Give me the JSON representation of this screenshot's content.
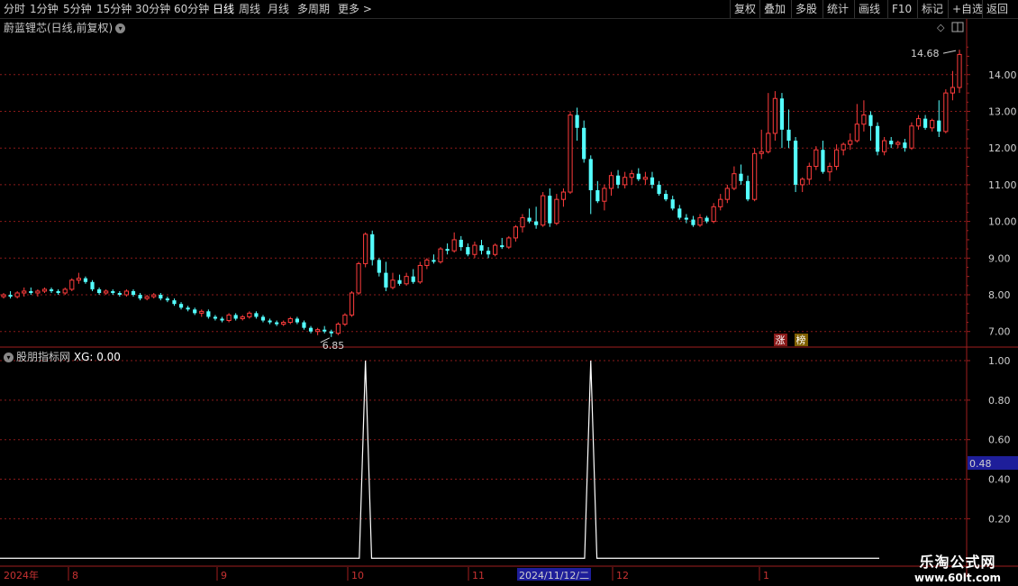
{
  "toolbar": {
    "periods": [
      "分时",
      "1分钟",
      "5分钟",
      "15分钟",
      "30分钟",
      "60分钟",
      "日线",
      "周线",
      "月线",
      "多周期",
      "更多 >"
    ],
    "active_period": "日线",
    "right_buttons": [
      "复权",
      "叠加",
      "多股",
      "统计",
      "画线",
      "F10",
      "标记",
      "+自选",
      "返回"
    ]
  },
  "main_panel": {
    "title": "蔚蓝锂芯(日线,前复权)",
    "high_label": "14.68",
    "low_label": "6.85",
    "badges": [
      "涨",
      "榜"
    ]
  },
  "sub_panel": {
    "title": "股朋指标网",
    "value_label": "XG: 0.00",
    "current_value": "0.48"
  },
  "timeline": {
    "labels": [
      "2024年",
      "8",
      "9",
      "10",
      "11",
      "12",
      "1"
    ],
    "highlighted_date": "2024/11/12/二"
  },
  "watermark": {
    "line1": "乐淘公式网",
    "line2": "www.60lt.com"
  },
  "colors": {
    "up": "#ff3c3c",
    "down": "#54ffff",
    "grid": "#8b1a1a",
    "axis": "#a01e1e",
    "signal": "#ffffff"
  },
  "chart_data": {
    "type": "candlestick",
    "main_yaxis": {
      "ticks": [
        7.0,
        8.0,
        9.0,
        10.0,
        11.0,
        12.0,
        13.0,
        14.0
      ],
      "ylim": [
        6.6,
        15.1
      ]
    },
    "sub_yaxis": {
      "ticks": [
        0.2,
        0.4,
        0.6,
        0.8,
        1.0
      ],
      "ylim": [
        -0.04,
        1.0
      ]
    },
    "candles_ohlc": [
      [
        7.95,
        8.05,
        7.9,
        8.0
      ],
      [
        8.0,
        8.1,
        7.9,
        7.95
      ],
      [
        7.95,
        8.1,
        7.9,
        8.05
      ],
      [
        8.05,
        8.2,
        7.95,
        8.1
      ],
      [
        8.1,
        8.2,
        8.0,
        8.05
      ],
      [
        8.05,
        8.15,
        7.95,
        8.1
      ],
      [
        8.1,
        8.2,
        8.05,
        8.15
      ],
      [
        8.15,
        8.2,
        8.05,
        8.1
      ],
      [
        8.1,
        8.15,
        8.0,
        8.05
      ],
      [
        8.05,
        8.2,
        8.0,
        8.15
      ],
      [
        8.15,
        8.45,
        8.1,
        8.4
      ],
      [
        8.4,
        8.6,
        8.3,
        8.45
      ],
      [
        8.45,
        8.5,
        8.3,
        8.35
      ],
      [
        8.35,
        8.4,
        8.1,
        8.15
      ],
      [
        8.15,
        8.2,
        8.0,
        8.05
      ],
      [
        8.05,
        8.15,
        8.0,
        8.1
      ],
      [
        8.1,
        8.15,
        8.0,
        8.05
      ],
      [
        8.05,
        8.1,
        7.95,
        8.0
      ],
      [
        8.0,
        8.15,
        7.95,
        8.1
      ],
      [
        8.1,
        8.15,
        7.95,
        8.0
      ],
      [
        8.0,
        8.05,
        7.85,
        7.9
      ],
      [
        7.9,
        8.0,
        7.85,
        7.95
      ],
      [
        7.95,
        8.05,
        7.9,
        8.0
      ],
      [
        8.0,
        8.05,
        7.85,
        7.9
      ],
      [
        7.9,
        7.95,
        7.8,
        7.85
      ],
      [
        7.85,
        7.9,
        7.7,
        7.75
      ],
      [
        7.75,
        7.8,
        7.6,
        7.65
      ],
      [
        7.65,
        7.7,
        7.55,
        7.6
      ],
      [
        7.6,
        7.65,
        7.45,
        7.5
      ],
      [
        7.5,
        7.6,
        7.4,
        7.55
      ],
      [
        7.55,
        7.6,
        7.35,
        7.4
      ],
      [
        7.4,
        7.45,
        7.3,
        7.35
      ],
      [
        7.35,
        7.4,
        7.25,
        7.3
      ],
      [
        7.3,
        7.5,
        7.25,
        7.45
      ],
      [
        7.45,
        7.5,
        7.3,
        7.35
      ],
      [
        7.35,
        7.45,
        7.3,
        7.4
      ],
      [
        7.4,
        7.55,
        7.35,
        7.5
      ],
      [
        7.5,
        7.55,
        7.35,
        7.4
      ],
      [
        7.4,
        7.45,
        7.25,
        7.3
      ],
      [
        7.3,
        7.35,
        7.2,
        7.25
      ],
      [
        7.25,
        7.3,
        7.15,
        7.2
      ],
      [
        7.2,
        7.3,
        7.15,
        7.25
      ],
      [
        7.25,
        7.4,
        7.2,
        7.35
      ],
      [
        7.35,
        7.4,
        7.2,
        7.25
      ],
      [
        7.25,
        7.3,
        7.05,
        7.1
      ],
      [
        7.1,
        7.15,
        6.95,
        7.0
      ],
      [
        7.0,
        7.1,
        6.9,
        7.05
      ],
      [
        7.05,
        7.15,
        6.95,
        7.0
      ],
      [
        7.0,
        7.05,
        6.85,
        6.95
      ],
      [
        6.95,
        7.25,
        6.9,
        7.2
      ],
      [
        7.2,
        7.5,
        7.15,
        7.45
      ],
      [
        7.45,
        8.1,
        7.4,
        8.05
      ],
      [
        8.05,
        8.9,
        8.0,
        8.85
      ],
      [
        8.85,
        9.7,
        8.75,
        9.65
      ],
      [
        9.65,
        9.75,
        8.8,
        8.95
      ],
      [
        8.95,
        9.0,
        8.5,
        8.6
      ],
      [
        8.6,
        8.9,
        8.1,
        8.2
      ],
      [
        8.2,
        8.6,
        8.15,
        8.4
      ],
      [
        8.4,
        8.55,
        8.25,
        8.3
      ],
      [
        8.3,
        8.6,
        8.25,
        8.5
      ],
      [
        8.5,
        8.7,
        8.3,
        8.35
      ],
      [
        8.35,
        8.9,
        8.3,
        8.8
      ],
      [
        8.8,
        9.0,
        8.7,
        8.95
      ],
      [
        8.95,
        9.1,
        8.85,
        8.9
      ],
      [
        8.9,
        9.3,
        8.85,
        9.25
      ],
      [
        9.25,
        9.4,
        9.1,
        9.2
      ],
      [
        9.2,
        9.7,
        9.15,
        9.5
      ],
      [
        9.5,
        9.6,
        9.2,
        9.3
      ],
      [
        9.3,
        9.4,
        9.05,
        9.1
      ],
      [
        9.1,
        9.45,
        9.0,
        9.35
      ],
      [
        9.35,
        9.5,
        9.1,
        9.2
      ],
      [
        9.2,
        9.3,
        9.0,
        9.1
      ],
      [
        9.1,
        9.4,
        9.05,
        9.35
      ],
      [
        9.35,
        9.55,
        9.25,
        9.3
      ],
      [
        9.3,
        9.6,
        9.25,
        9.55
      ],
      [
        9.55,
        9.9,
        9.45,
        9.85
      ],
      [
        9.85,
        10.2,
        9.7,
        10.1
      ],
      [
        10.1,
        10.35,
        9.95,
        10.0
      ],
      [
        10.0,
        10.4,
        9.8,
        9.9
      ],
      [
        9.9,
        10.8,
        9.85,
        10.7
      ],
      [
        10.7,
        10.9,
        9.85,
        9.95
      ],
      [
        9.95,
        10.75,
        9.9,
        10.6
      ],
      [
        10.6,
        10.9,
        10.4,
        10.8
      ],
      [
        10.8,
        13.0,
        10.75,
        12.9
      ],
      [
        12.9,
        13.1,
        12.2,
        12.55
      ],
      [
        12.55,
        12.75,
        11.6,
        11.7
      ],
      [
        11.7,
        11.8,
        10.2,
        10.85
      ],
      [
        10.85,
        11.1,
        10.5,
        10.55
      ],
      [
        10.55,
        11.0,
        10.3,
        10.9
      ],
      [
        10.9,
        11.35,
        10.7,
        11.25
      ],
      [
        11.25,
        11.4,
        10.9,
        11.0
      ],
      [
        11.0,
        11.35,
        10.9,
        11.2
      ],
      [
        11.2,
        11.4,
        11.0,
        11.3
      ],
      [
        11.3,
        11.45,
        11.1,
        11.15
      ],
      [
        11.15,
        11.35,
        11.0,
        11.2
      ],
      [
        11.2,
        11.35,
        10.9,
        11.0
      ],
      [
        11.0,
        11.1,
        10.7,
        10.75
      ],
      [
        10.75,
        10.85,
        10.55,
        10.6
      ],
      [
        10.6,
        10.7,
        10.3,
        10.35
      ],
      [
        10.35,
        10.45,
        10.05,
        10.1
      ],
      [
        10.1,
        10.2,
        9.95,
        10.05
      ],
      [
        10.05,
        10.15,
        9.85,
        9.9
      ],
      [
        9.9,
        10.2,
        9.85,
        10.1
      ],
      [
        10.1,
        10.15,
        9.95,
        10.0
      ],
      [
        10.0,
        10.5,
        9.95,
        10.4
      ],
      [
        10.4,
        10.75,
        10.3,
        10.6
      ],
      [
        10.6,
        11.0,
        10.5,
        10.9
      ],
      [
        10.9,
        11.5,
        10.85,
        11.3
      ],
      [
        11.3,
        11.55,
        11.0,
        11.1
      ],
      [
        11.1,
        11.25,
        10.55,
        10.6
      ],
      [
        10.6,
        12.0,
        10.55,
        11.85
      ],
      [
        11.85,
        12.5,
        11.7,
        11.9
      ],
      [
        11.9,
        13.5,
        11.85,
        12.4
      ],
      [
        12.4,
        13.55,
        12.2,
        13.35
      ],
      [
        13.35,
        13.5,
        12.0,
        12.5
      ],
      [
        12.5,
        13.05,
        12.0,
        12.2
      ],
      [
        12.2,
        12.3,
        10.8,
        11.0
      ],
      [
        11.0,
        11.2,
        10.8,
        11.15
      ],
      [
        11.15,
        11.6,
        11.0,
        11.5
      ],
      [
        11.5,
        12.05,
        11.4,
        11.95
      ],
      [
        11.95,
        12.2,
        11.3,
        11.35
      ],
      [
        11.35,
        11.6,
        11.1,
        11.5
      ],
      [
        11.5,
        12.1,
        11.4,
        11.95
      ],
      [
        11.95,
        12.15,
        11.8,
        12.1
      ],
      [
        12.1,
        12.4,
        11.95,
        12.2
      ],
      [
        12.2,
        13.2,
        12.15,
        12.65
      ],
      [
        12.65,
        13.3,
        12.45,
        12.9
      ],
      [
        12.9,
        13.0,
        12.2,
        12.6
      ],
      [
        12.6,
        12.7,
        11.8,
        11.9
      ],
      [
        11.9,
        12.3,
        11.8,
        12.2
      ],
      [
        12.2,
        12.3,
        12.0,
        12.1
      ],
      [
        12.1,
        12.2,
        12.0,
        12.15
      ],
      [
        12.15,
        12.25,
        11.9,
        12.0
      ],
      [
        12.0,
        12.7,
        11.95,
        12.6
      ],
      [
        12.6,
        12.9,
        12.5,
        12.8
      ],
      [
        12.8,
        12.9,
        12.5,
        12.55
      ],
      [
        12.55,
        12.8,
        12.45,
        12.75
      ],
      [
        12.75,
        13.3,
        12.3,
        12.45
      ],
      [
        12.45,
        13.6,
        12.4,
        13.5
      ],
      [
        13.5,
        14.1,
        13.3,
        13.65
      ],
      [
        13.65,
        14.68,
        13.5,
        14.55
      ]
    ],
    "signal_xg": {
      "spike_indices": [
        53,
        86
      ],
      "spike_value": 1.0,
      "base_value": 0.0
    }
  }
}
